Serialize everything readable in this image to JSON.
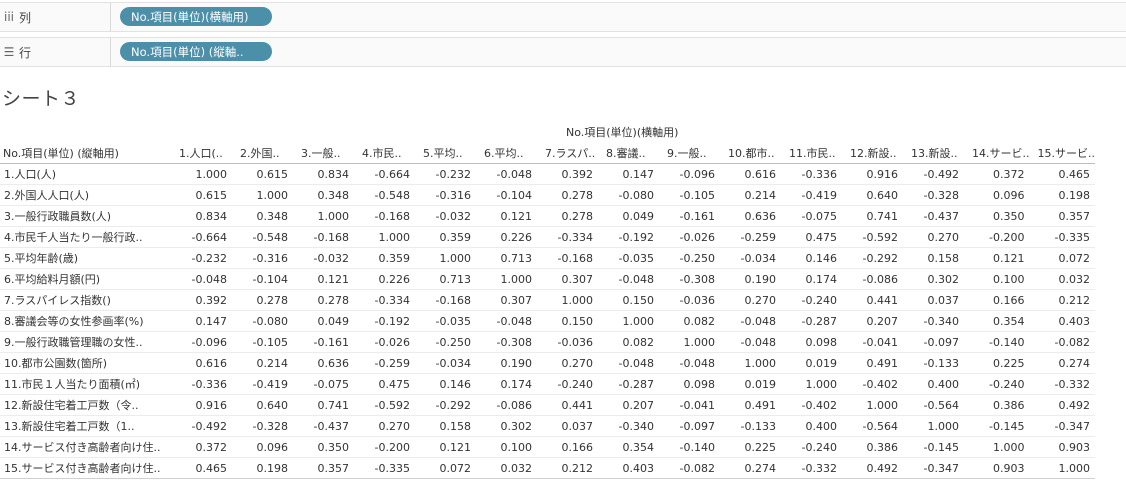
{
  "shelves": {
    "columns": {
      "icon": "iii",
      "label": "列",
      "pill": "No.項目(単位)(横軸用)"
    },
    "rows": {
      "icon": "☰",
      "label": "行",
      "pill": "No.項目(単位) (縦軸.."
    }
  },
  "sheet_title": "シート３",
  "table": {
    "column_group_title": "No.項目(単位)(横軸用)",
    "row_header_title": "No.項目(単位) (縦軸用)",
    "column_headers": [
      "1.人口(..",
      "2.外国..",
      "3.一般..",
      "4.市民..",
      "5.平均..",
      "6.平均..",
      "7.ラスパ..",
      "8.審議..",
      "9.一般..",
      "10.都市..",
      "11.市民..",
      "12.新設..",
      "13.新設..",
      "14.サービ..",
      "15.サービ.."
    ],
    "rows": [
      {
        "label": "1.人口(人)",
        "values": [
          "1.000",
          "0.615",
          "0.834",
          "-0.664",
          "-0.232",
          "-0.048",
          "0.392",
          "0.147",
          "-0.096",
          "0.616",
          "-0.336",
          "0.916",
          "-0.492",
          "0.372",
          "0.465"
        ]
      },
      {
        "label": "2.外国人人口(人)",
        "values": [
          "0.615",
          "1.000",
          "0.348",
          "-0.548",
          "-0.316",
          "-0.104",
          "0.278",
          "-0.080",
          "-0.105",
          "0.214",
          "-0.419",
          "0.640",
          "-0.328",
          "0.096",
          "0.198"
        ]
      },
      {
        "label": "3.一般行政職員数(人)",
        "values": [
          "0.834",
          "0.348",
          "1.000",
          "-0.168",
          "-0.032",
          "0.121",
          "0.278",
          "0.049",
          "-0.161",
          "0.636",
          "-0.075",
          "0.741",
          "-0.437",
          "0.350",
          "0.357"
        ]
      },
      {
        "label": "4.市民千人当たり一般行政..",
        "values": [
          "-0.664",
          "-0.548",
          "-0.168",
          "1.000",
          "0.359",
          "0.226",
          "-0.334",
          "-0.192",
          "-0.026",
          "-0.259",
          "0.475",
          "-0.592",
          "0.270",
          "-0.200",
          "-0.335"
        ]
      },
      {
        "label": "5.平均年齢(歳)",
        "values": [
          "-0.232",
          "-0.316",
          "-0.032",
          "0.359",
          "1.000",
          "0.713",
          "-0.168",
          "-0.035",
          "-0.250",
          "-0.034",
          "0.146",
          "-0.292",
          "0.158",
          "0.121",
          "0.072"
        ]
      },
      {
        "label": "6.平均給料月額(円)",
        "values": [
          "-0.048",
          "-0.104",
          "0.121",
          "0.226",
          "0.713",
          "1.000",
          "0.307",
          "-0.048",
          "-0.308",
          "0.190",
          "0.174",
          "-0.086",
          "0.302",
          "0.100",
          "0.032"
        ]
      },
      {
        "label": "7.ラスパイレス指数()",
        "values": [
          "0.392",
          "0.278",
          "0.278",
          "-0.334",
          "-0.168",
          "0.307",
          "1.000",
          "0.150",
          "-0.036",
          "0.270",
          "-0.240",
          "0.441",
          "0.037",
          "0.166",
          "0.212"
        ]
      },
      {
        "label": "8.審議会等の女性参画率(%)",
        "values": [
          "0.147",
          "-0.080",
          "0.049",
          "-0.192",
          "-0.035",
          "-0.048",
          "0.150",
          "1.000",
          "0.082",
          "-0.048",
          "-0.287",
          "0.207",
          "-0.340",
          "0.354",
          "0.403"
        ]
      },
      {
        "label": "9.一般行政職管理職の女性..",
        "values": [
          "-0.096",
          "-0.105",
          "-0.161",
          "-0.026",
          "-0.250",
          "-0.308",
          "-0.036",
          "0.082",
          "1.000",
          "-0.048",
          "0.098",
          "-0.041",
          "-0.097",
          "-0.140",
          "-0.082"
        ]
      },
      {
        "label": "10.都市公園数(箇所)",
        "values": [
          "0.616",
          "0.214",
          "0.636",
          "-0.259",
          "-0.034",
          "0.190",
          "0.270",
          "-0.048",
          "-0.048",
          "1.000",
          "0.019",
          "0.491",
          "-0.133",
          "0.225",
          "0.274"
        ]
      },
      {
        "label": "11.市民１人当たり面積(㎡)",
        "values": [
          "-0.336",
          "-0.419",
          "-0.075",
          "0.475",
          "0.146",
          "0.174",
          "-0.240",
          "-0.287",
          "0.098",
          "0.019",
          "1.000",
          "-0.402",
          "0.400",
          "-0.240",
          "-0.332"
        ]
      },
      {
        "label": "12.新設住宅着工戸数（令..",
        "values": [
          "0.916",
          "0.640",
          "0.741",
          "-0.592",
          "-0.292",
          "-0.086",
          "0.441",
          "0.207",
          "-0.041",
          "0.491",
          "-0.402",
          "1.000",
          "-0.564",
          "0.386",
          "0.492"
        ]
      },
      {
        "label": "13.新設住宅着工戸数（1..",
        "values": [
          "-0.492",
          "-0.328",
          "-0.437",
          "0.270",
          "0.158",
          "0.302",
          "0.037",
          "-0.340",
          "-0.097",
          "-0.133",
          "0.400",
          "-0.564",
          "1.000",
          "-0.145",
          "-0.347"
        ]
      },
      {
        "label": "14.サービス付き高齢者向け住..",
        "values": [
          "0.372",
          "0.096",
          "0.350",
          "-0.200",
          "0.121",
          "0.100",
          "0.166",
          "0.354",
          "-0.140",
          "0.225",
          "-0.240",
          "0.386",
          "-0.145",
          "1.000",
          "0.903"
        ]
      },
      {
        "label": "15.サービス付き高齢者向け住..",
        "values": [
          "0.465",
          "0.198",
          "0.357",
          "-0.335",
          "0.072",
          "0.032",
          "0.212",
          "0.403",
          "-0.082",
          "0.274",
          "-0.332",
          "0.492",
          "-0.347",
          "0.903",
          "1.000"
        ]
      }
    ]
  }
}
